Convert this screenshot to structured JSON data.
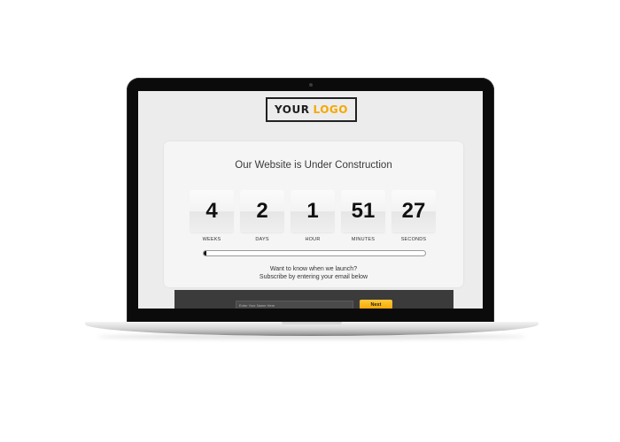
{
  "logo": {
    "word1": "YOUR",
    "word2": "LOGO",
    "accent_color": "#f5a800"
  },
  "headline": "Our Website is Under Construction",
  "countdown": [
    {
      "value": "4",
      "label": "WEEKS"
    },
    {
      "value": "2",
      "label": "DAYS"
    },
    {
      "value": "1",
      "label": "HOUR"
    },
    {
      "value": "51",
      "label": "MINUTES"
    },
    {
      "value": "27",
      "label": "SECONDS"
    }
  ],
  "progress": {
    "fraction": 0.01
  },
  "subscribe": {
    "line1": "Want to know when we launch?",
    "line2": "Subscribe by entering your email below",
    "email_placeholder": "Enter Your Name Here",
    "email_value": "",
    "button_label": "Next",
    "button_color": "#f5a800"
  }
}
